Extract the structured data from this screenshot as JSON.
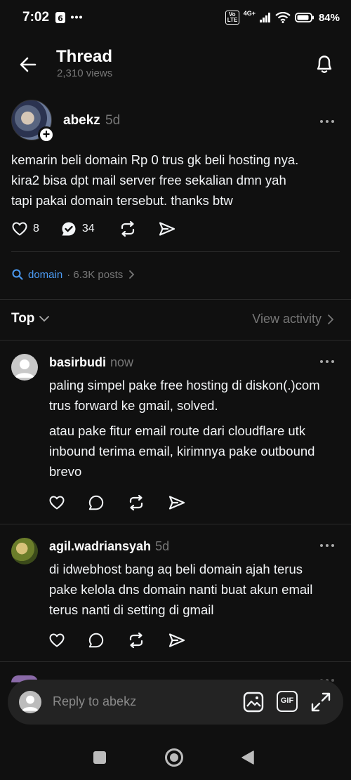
{
  "status": {
    "time": "7:02",
    "battery": "84%",
    "network": "4G+",
    "volte": "Vo LTE"
  },
  "header": {
    "title": "Thread",
    "views": "2,310 views"
  },
  "post": {
    "username": "abekz",
    "time": "5d",
    "lines": [
      "kemarin beli domain Rp 0 trus gk beli hosting nya.",
      "kira2 bisa dpt mail server free sekalian dmn yah",
      "tapi pakai domain tersebut. thanks btw"
    ],
    "likes": "8",
    "replies": "34"
  },
  "topic": {
    "tag": "domain",
    "posts": "· 6.3K posts"
  },
  "sort": {
    "label": "Top",
    "view_activity": "View activity"
  },
  "replies": [
    {
      "username": "basirbudi",
      "time": "now",
      "paragraph1": [
        "paling simpel pake free hosting di diskon(.)com",
        "trus forward ke gmail, solved."
      ],
      "paragraph2": [
        "atau pake fitur email route dari cloudflare utk",
        "inbound terima email, kirimnya pake outbound",
        "brevo"
      ]
    },
    {
      "username": "agil.wadriansyah",
      "time": "5d",
      "paragraph1": [
        "di idwebhost bang aq beli domain ajah terus",
        "pake kelola dns domain nanti buat akun email",
        "terus nanti di setting di gmail"
      ]
    }
  ],
  "composer": {
    "placeholder": "Reply to abekz",
    "gif_label": "GIF"
  },
  "icons": {
    "back": "arrow-left-icon",
    "bell": "bell-icon",
    "more": "more-horizontal-icon",
    "like": "heart-icon",
    "reply": "comment-icon",
    "repost": "repost-icon",
    "share": "send-icon",
    "search": "search-icon",
    "image": "image-icon",
    "expand": "expand-icon"
  },
  "colors": {
    "background": "#101010",
    "link": "#4c9cf5",
    "muted": "#777777"
  }
}
